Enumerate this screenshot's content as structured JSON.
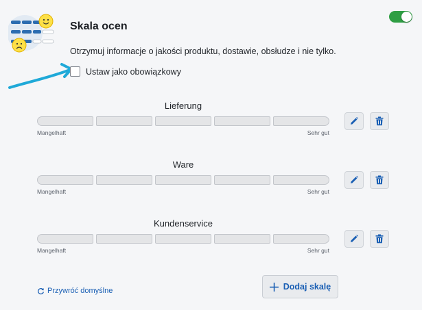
{
  "header": {
    "title": "Skala ocen",
    "description": "Otrzymuj informacje o jakości produktu, dostawie, obsłudze i nie tylko.",
    "enabled": true
  },
  "mandatory_checkbox": {
    "label": "Ustaw jako obowiązkowy",
    "checked": false
  },
  "scales": [
    {
      "name": "Lieferung",
      "min_label": "Mangelhaft",
      "max_label": "Sehr gut",
      "segments": 5
    },
    {
      "name": "Ware",
      "min_label": "Mangelhaft",
      "max_label": "Sehr gut",
      "segments": 5
    },
    {
      "name": "Kundenservice",
      "min_label": "Mangelhaft",
      "max_label": "Sehr gut",
      "segments": 5
    }
  ],
  "footer": {
    "reset_label": "Przywróć domyślne",
    "add_label": "Dodaj skalę"
  },
  "icons": {
    "edit": "pencil-icon",
    "delete": "trash-icon",
    "reset": "refresh-icon",
    "add": "plus-icon",
    "logo": "rating-scale-illustration"
  },
  "colors": {
    "accent": "#1a5fb4",
    "toggle_on": "#2f9e44",
    "arrow": "#1fa9d8"
  }
}
